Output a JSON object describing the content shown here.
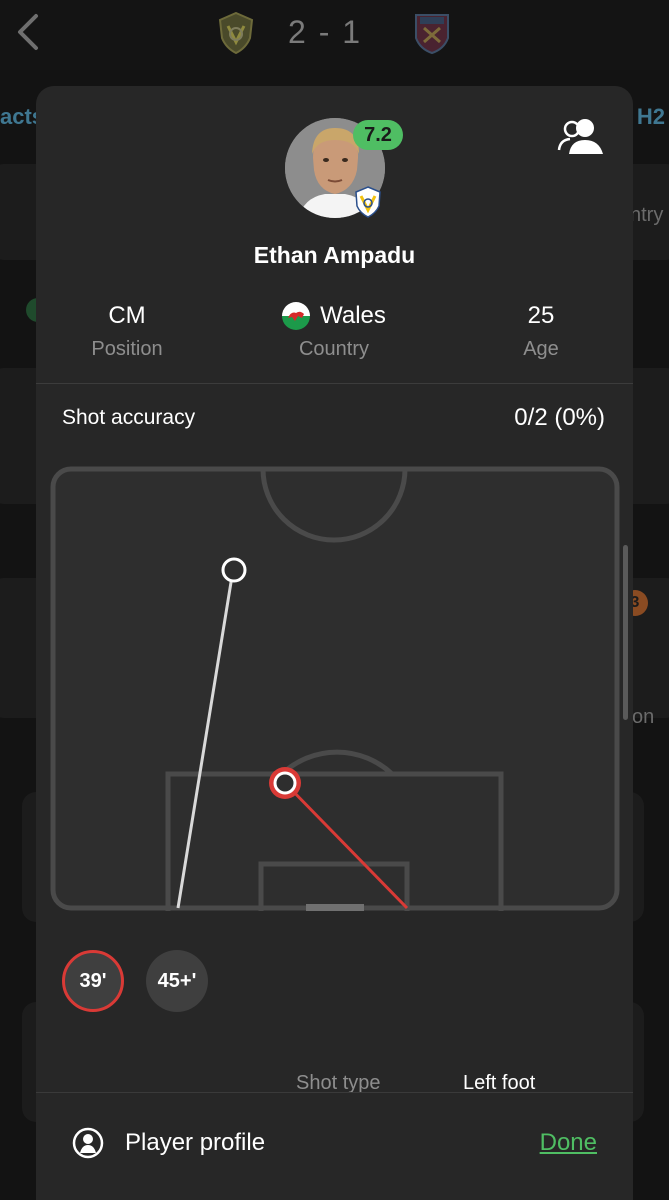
{
  "match": {
    "score": "2 - 1",
    "home_crest": "leeds-crest",
    "away_crest": "west-ham-crest"
  },
  "background": {
    "tab_left": "acts",
    "tab_right": "H2",
    "card_text_1": "ntry",
    "card_text_2": "on",
    "badge": "3"
  },
  "player": {
    "name": "Ethan Ampadu",
    "rating": "7.2",
    "position_value": "CM",
    "position_label": "Position",
    "country_value": "Wales",
    "country_label": "Country",
    "age_value": "25",
    "age_label": "Age"
  },
  "shots": {
    "accuracy_label": "Shot accuracy",
    "accuracy_value": "0/2 (0%)",
    "buttons": [
      {
        "label": "39'",
        "active": true
      },
      {
        "label": "45+'",
        "active": false
      }
    ],
    "detail_label": "Shot type",
    "detail_value": "Left foot"
  },
  "footer": {
    "profile_label": "Player profile",
    "done_label": "Done"
  },
  "colors": {
    "accent_green": "#4fbe63",
    "shot_red": "#d93a36",
    "sheet_bg": "#272727"
  }
}
